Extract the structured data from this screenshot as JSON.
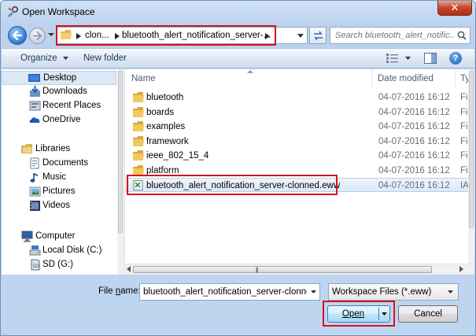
{
  "window": {
    "title": "Open Workspace",
    "close_label": "✕"
  },
  "address": {
    "crumbs": [
      "clon...",
      "bluetooth_alert_notification_server-..."
    ],
    "refresh_icon": "refresh-icon"
  },
  "search": {
    "placeholder": "Search bluetooth_alert_notific..."
  },
  "toolbar": {
    "organize_label": "Organize",
    "new_folder_label": "New folder"
  },
  "nav": {
    "favorites": [
      {
        "label": "Desktop",
        "icon": "desktop-icon",
        "selected": true
      },
      {
        "label": "Downloads",
        "icon": "downloads-icon"
      },
      {
        "label": "Recent Places",
        "icon": "recent-places-icon"
      },
      {
        "label": "OneDrive",
        "icon": "onedrive-icon"
      }
    ],
    "libraries_label": "Libraries",
    "libraries": [
      {
        "label": "Documents",
        "icon": "documents-icon"
      },
      {
        "label": "Music",
        "icon": "music-icon"
      },
      {
        "label": "Pictures",
        "icon": "pictures-icon"
      },
      {
        "label": "Videos",
        "icon": "videos-icon"
      }
    ],
    "computer_label": "Computer",
    "drives": [
      {
        "label": "Local Disk (C:)",
        "icon": "local-disk-icon"
      },
      {
        "label": "SD (G:)",
        "icon": "sd-card-icon"
      }
    ]
  },
  "files": {
    "columns": [
      "Name",
      "Date modified",
      "Ty"
    ],
    "rows": [
      {
        "name": "bluetooth",
        "date": "04-07-2016 16:12",
        "type": "Fil",
        "kind": "folder"
      },
      {
        "name": "boards",
        "date": "04-07-2016 16:12",
        "type": "Fil",
        "kind": "folder"
      },
      {
        "name": "examples",
        "date": "04-07-2016 16:12",
        "type": "Fil",
        "kind": "folder"
      },
      {
        "name": "framework",
        "date": "04-07-2016 16:12",
        "type": "Fil",
        "kind": "folder"
      },
      {
        "name": "ieee_802_15_4",
        "date": "04-07-2016 16:12",
        "type": "Fil",
        "kind": "folder"
      },
      {
        "name": "platform",
        "date": "04-07-2016 16:12",
        "type": "Fil",
        "kind": "folder"
      },
      {
        "name": "bluetooth_alert_notification_server-clonned.eww",
        "date": "04-07-2016 16:12",
        "type": "IAI",
        "kind": "file",
        "selected": true
      }
    ]
  },
  "bottom": {
    "file_name_label_pre": "File ",
    "file_name_label_u": "n",
    "file_name_label_post": "ame:",
    "file_name_value": "bluetooth_alert_notification_server-clonned.e",
    "file_type_value": "Workspace Files (*.eww)",
    "open_label": "Open",
    "cancel_label": "Cancel"
  },
  "colors": {
    "highlight_box": "#d4141a",
    "folder": "#e8b84a",
    "selection": "#dce9f8"
  }
}
